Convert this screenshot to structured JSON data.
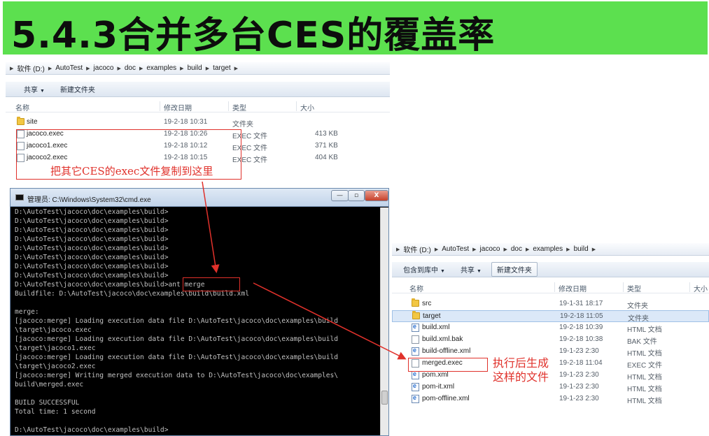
{
  "title": "5.4.3合并多台CES的覆盖率",
  "colors": {
    "banner": "#5ce04f",
    "annotation": "#e0312b"
  },
  "explorer_left": {
    "breadcrumb": [
      "软件 (D:)",
      "AutoTest",
      "jacoco",
      "doc",
      "examples",
      "build",
      "target"
    ],
    "toolbar": {
      "share": "共享",
      "new_folder": "新建文件夹"
    },
    "columns": {
      "name": "名称",
      "date": "修改日期",
      "type": "类型",
      "size": "大小"
    },
    "files": [
      {
        "name": "site",
        "date": "19-2-18 10:31",
        "type": "文件夹",
        "size": "",
        "icon": "folder-icon"
      },
      {
        "name": "jacoco.exec",
        "date": "19-2-18 10:26",
        "type": "EXEC 文件",
        "size": "413 KB",
        "icon": "file-icon"
      },
      {
        "name": "jacoco1.exec",
        "date": "19-2-18 10:12",
        "type": "EXEC 文件",
        "size": "371 KB",
        "icon": "file-icon"
      },
      {
        "name": "jacoco2.exec",
        "date": "19-2-18 10:15",
        "type": "EXEC 文件",
        "size": "404 KB",
        "icon": "file-icon"
      }
    ],
    "annotation": "把其它CES的exec文件复制到这里"
  },
  "cmd": {
    "title": "管理员: C:\\Windows\\System32\\cmd.exe",
    "buttons": {
      "minimize": "—",
      "maximize": "▫",
      "close": "X"
    },
    "lines": [
      "D:\\AutoTest\\jacoco\\doc\\examples\\build>",
      "D:\\AutoTest\\jacoco\\doc\\examples\\build>",
      "D:\\AutoTest\\jacoco\\doc\\examples\\build>",
      "D:\\AutoTest\\jacoco\\doc\\examples\\build>",
      "D:\\AutoTest\\jacoco\\doc\\examples\\build>",
      "D:\\AutoTest\\jacoco\\doc\\examples\\build>",
      "D:\\AutoTest\\jacoco\\doc\\examples\\build>",
      "D:\\AutoTest\\jacoco\\doc\\examples\\build>",
      "D:\\AutoTest\\jacoco\\doc\\examples\\build>ant merge",
      "Buildfile: D:\\AutoTest\\jacoco\\doc\\examples\\build\\build.xml",
      "",
      "merge:",
      "[jacoco:merge] Loading execution data file D:\\AutoTest\\jacoco\\doc\\examples\\build",
      "\\target\\jacoco.exec",
      "[jacoco:merge] Loading execution data file D:\\AutoTest\\jacoco\\doc\\examples\\build",
      "\\target\\jacoco1.exec",
      "[jacoco:merge] Loading execution data file D:\\AutoTest\\jacoco\\doc\\examples\\build",
      "\\target\\jacoco2.exec",
      "[jacoco:merge] Writing merged execution data to D:\\AutoTest\\jacoco\\doc\\examples\\",
      "build\\merged.exec",
      "",
      "BUILD SUCCESSFUL",
      "Total time: 1 second",
      "",
      "D:\\AutoTest\\jacoco\\doc\\examples\\build>"
    ]
  },
  "explorer_right": {
    "breadcrumb": [
      "软件 (D:)",
      "AutoTest",
      "jacoco",
      "doc",
      "examples",
      "build"
    ],
    "toolbar": {
      "include_library": "包含到库中",
      "share": "共享",
      "new_folder": "新建文件夹"
    },
    "columns": {
      "name": "名称",
      "date": "修改日期",
      "type": "类型",
      "size": "大小"
    },
    "files": [
      {
        "name": "src",
        "date": "19-1-31 18:17",
        "type": "文件夹",
        "icon": "folder-icon",
        "selected": false
      },
      {
        "name": "target",
        "date": "19-2-18 11:05",
        "type": "文件夹",
        "icon": "folder-icon",
        "selected": true
      },
      {
        "name": "build.xml",
        "date": "19-2-18 10:39",
        "type": "HTML 文档",
        "icon": "xml-file-icon",
        "selected": false
      },
      {
        "name": "build.xml.bak",
        "date": "19-2-18 10:38",
        "type": "BAK 文件",
        "icon": "file-icon",
        "selected": false
      },
      {
        "name": "build-offline.xml",
        "date": "19-1-23 2:30",
        "type": "HTML 文档",
        "icon": "xml-file-icon",
        "selected": false
      },
      {
        "name": "merged.exec",
        "date": "19-2-18 11:04",
        "type": "EXEC 文件",
        "icon": "file-icon",
        "selected": false
      },
      {
        "name": "pom.xml",
        "date": "19-1-23 2:30",
        "type": "HTML 文档",
        "icon": "xml-file-icon",
        "selected": false
      },
      {
        "name": "pom-it.xml",
        "date": "19-1-23 2:30",
        "type": "HTML 文档",
        "icon": "xml-file-icon",
        "selected": false
      },
      {
        "name": "pom-offline.xml",
        "date": "19-1-23 2:30",
        "type": "HTML 文档",
        "icon": "xml-file-icon",
        "selected": false
      }
    ],
    "annotation_line1": "执行后生成",
    "annotation_line2": "这样的文件"
  }
}
